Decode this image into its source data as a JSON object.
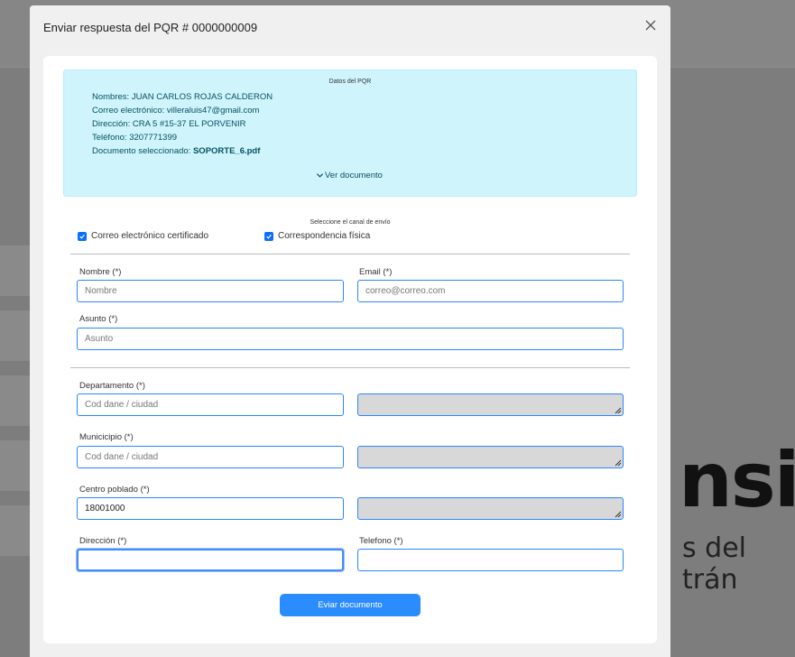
{
  "background": {
    "brand_text": "nsit",
    "brand_subtext": "s del trán"
  },
  "modal": {
    "title": "Enviar respuesta del PQR # 0000000009"
  },
  "pqr_info": {
    "heading": "Datos del PQR",
    "nombres": "Nombres: JUAN CARLOS ROJAS CALDERON",
    "correo": "Correo electrónico: villeraluis47@gmail.com",
    "direccion": "Dirección: CRA 5 #15-37 EL PORVENIR",
    "telefono": "Teléfono: 3207771399",
    "documento_label": "Documento seleccionado: ",
    "documento_value": "SOPORTE_6.pdf",
    "ver_documento": "Ver documento"
  },
  "channel": {
    "heading": "Seleccione el canal de envío",
    "option_email": "Correo electrónico certificado",
    "option_physical": "Correspondencia física",
    "option_email_checked": true,
    "option_physical_checked": true
  },
  "form": {
    "nombre_label": "Nombre (*)",
    "nombre_placeholder": "Nombre",
    "email_label": "Email (*)",
    "email_placeholder": "correo@correo.com",
    "asunto_label": "Asunto (*)",
    "asunto_placeholder": "Asunto",
    "departamento_label": "Departamento (*)",
    "departamento_placeholder": "Cod dane / ciudad",
    "municipio_label": "Municicipio (*)",
    "municipio_placeholder": "Cod dane / ciudad",
    "centro_label": "Centro poblado (*)",
    "centro_value": "18001000",
    "direccion_label": "Dirección (*)",
    "telefono_label": "Telefono (*)"
  },
  "submit_label": "Eviar documento",
  "colors": {
    "accent": "#2b8cff",
    "info_bg": "#cff4fc",
    "info_text": "#055160"
  }
}
